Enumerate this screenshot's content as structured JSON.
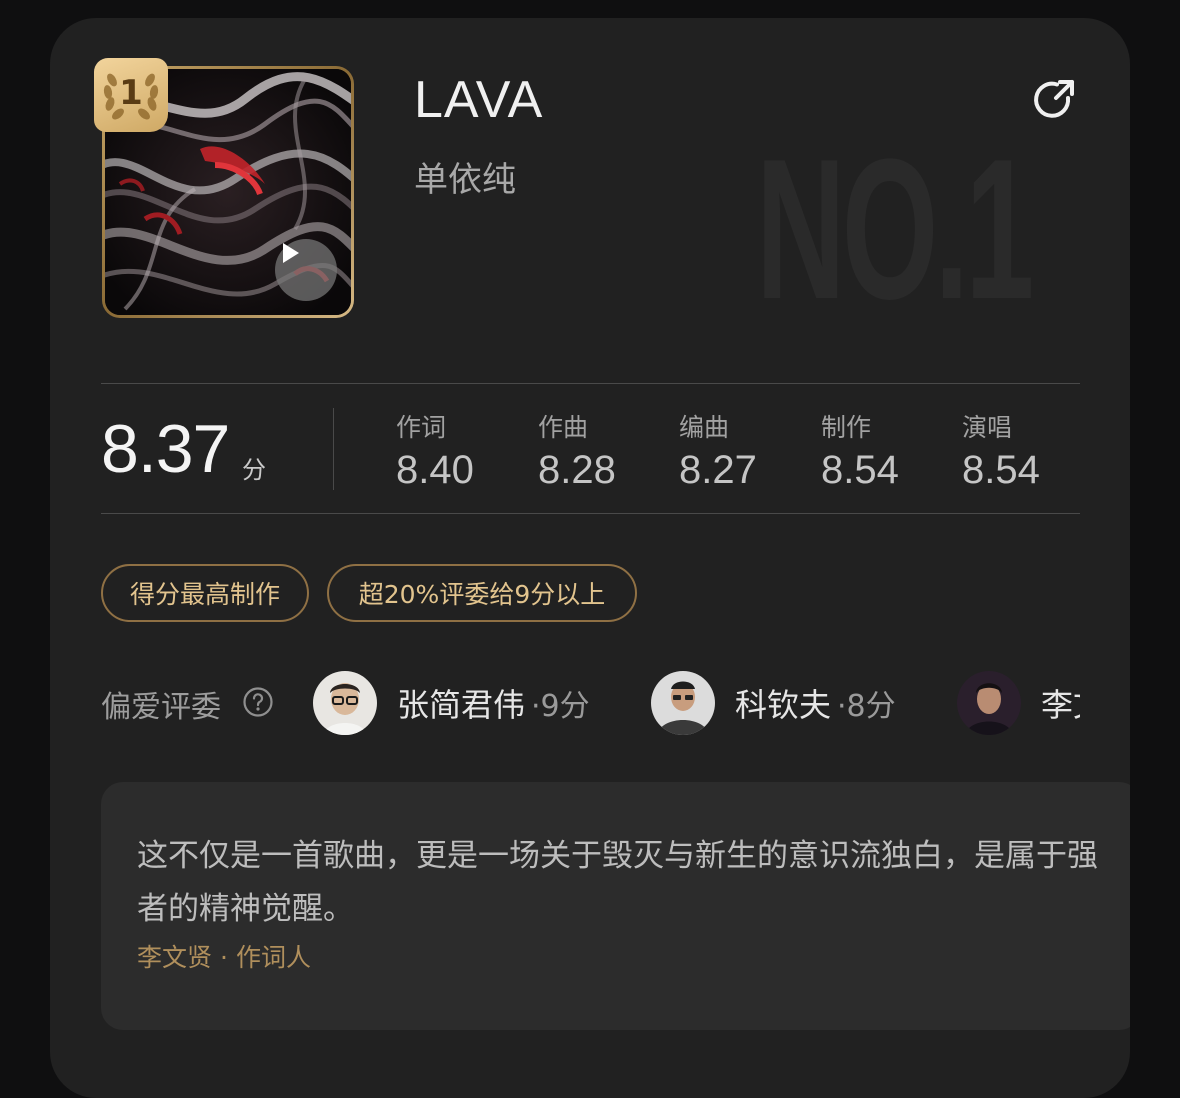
{
  "song": {
    "title": "LAVA",
    "artist": "单依纯",
    "rank": "1",
    "watermark": "NO.1"
  },
  "scores": {
    "total": "8.37",
    "total_unit": "分",
    "items": [
      {
        "label": "作词",
        "value": "8.40"
      },
      {
        "label": "作曲",
        "value": "8.28"
      },
      {
        "label": "编曲",
        "value": "8.27"
      },
      {
        "label": "制作",
        "value": "8.54"
      },
      {
        "label": "演唱",
        "value": "8.54"
      }
    ]
  },
  "tags": [
    "得分最高制作",
    "超20%评委给9分以上"
  ],
  "judges": {
    "label": "偏爱评委",
    "items": [
      {
        "name": "张简君伟",
        "score": "·9分"
      },
      {
        "name": "科钦夫",
        "score": "·8分"
      },
      {
        "name": "李文",
        "score": ""
      }
    ]
  },
  "quote": {
    "text": "这不仅是一首歌曲，更是一场关于毁灭与新生的意识流独白，是属于强者的精神觉醒。",
    "author": "李文贤",
    "role": "作词人"
  },
  "colors": {
    "background": "#0f0f10",
    "card": "#212121",
    "gold": "#e2c48e",
    "quote_box": "#2c2c2c"
  }
}
